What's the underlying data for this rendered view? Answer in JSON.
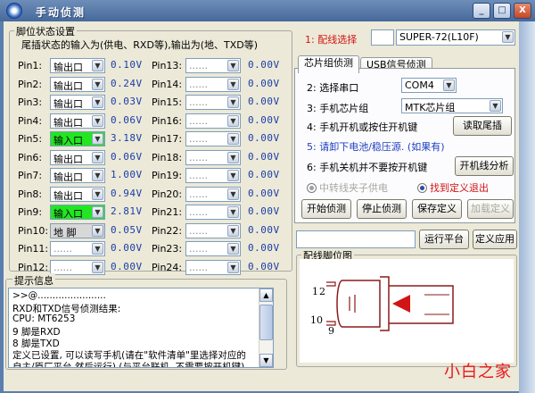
{
  "window": {
    "title": "手动侦测",
    "btn_min": "_",
    "btn_max": "□",
    "btn_close": "X"
  },
  "pin_group": {
    "title": "脚位状态设置",
    "desc": "尾插状态的输入为(供电、RXD等),输出为(地、TXD等)",
    "left_pins": [
      {
        "label": "Pin1:",
        "mode": "输出口",
        "value": "0.10V",
        "style": "normal"
      },
      {
        "label": "Pin2:",
        "mode": "输出口",
        "value": "0.24V",
        "style": "normal"
      },
      {
        "label": "Pin3:",
        "mode": "输出口",
        "value": "0.03V",
        "style": "normal"
      },
      {
        "label": "Pin4:",
        "mode": "输出口",
        "value": "0.06V",
        "style": "normal"
      },
      {
        "label": "Pin5:",
        "mode": "输入口",
        "value": "3.18V",
        "style": "green"
      },
      {
        "label": "Pin6:",
        "mode": "输出口",
        "value": "0.06V",
        "style": "normal"
      },
      {
        "label": "Pin7:",
        "mode": "输出口",
        "value": "1.00V",
        "style": "normal"
      },
      {
        "label": "Pin8:",
        "mode": "输出口",
        "value": "0.94V",
        "style": "normal"
      },
      {
        "label": "Pin9:",
        "mode": "输入口",
        "value": "2.81V",
        "style": "green"
      },
      {
        "label": "Pin10:",
        "mode": "地 脚",
        "value": "0.05V",
        "style": "gray"
      },
      {
        "label": "Pin11:",
        "mode": "......",
        "value": "0.00V",
        "style": "dotted"
      },
      {
        "label": "Pin12:",
        "mode": "......",
        "value": "0.00V",
        "style": "dotted"
      }
    ],
    "right_pins": [
      {
        "label": "Pin13:",
        "mode": "......",
        "value": "0.00V"
      },
      {
        "label": "Pin14:",
        "mode": "......",
        "value": "0.00V"
      },
      {
        "label": "Pin15:",
        "mode": "......",
        "value": "0.00V"
      },
      {
        "label": "Pin16:",
        "mode": "......",
        "value": "0.00V"
      },
      {
        "label": "Pin17:",
        "mode": "......",
        "value": "0.00V"
      },
      {
        "label": "Pin18:",
        "mode": "......",
        "value": "0.00V"
      },
      {
        "label": "Pin19:",
        "mode": "......",
        "value": "0.00V"
      },
      {
        "label": "Pin20:",
        "mode": "......",
        "value": "0.00V"
      },
      {
        "label": "Pin21:",
        "mode": "......",
        "value": "0.00V"
      },
      {
        "label": "Pin22:",
        "mode": "......",
        "value": "0.00V"
      },
      {
        "label": "Pin23:",
        "mode": "......",
        "value": "0.00V"
      },
      {
        "label": "Pin24:",
        "mode": "......",
        "value": "0.00V"
      }
    ]
  },
  "cable": {
    "label": "1: 配线选择",
    "value": "SUPER-72(L10F)"
  },
  "tabs": {
    "chip": "芯片组侦测",
    "usb": "USB信号侦测"
  },
  "chip_panel": {
    "step2": "2: 选择串口",
    "port": "COM4",
    "step3": "3: 手机芯片组",
    "chipset": "MTK芯片组",
    "step4": "4: 手机开机或按住开机键",
    "read_tail": "读取尾插",
    "step5": "5: 请卸下电池/稳压源. (如果有)",
    "step6": "6: 手机关机并不要按开机键",
    "boot_analysis": "开机线分析",
    "opt_clip": "中转线夹子供电",
    "opt_found": "找到定义退出",
    "start": "开始侦测",
    "stop": "停止侦测",
    "save": "保存定义",
    "restore": "加载定义"
  },
  "platform": {
    "run": "运行平台",
    "define": "定义应用"
  },
  "diagram": {
    "title": "配线脚位图",
    "pin1": "1",
    "pin2": "2",
    "pin9": "9",
    "pin10": "10"
  },
  "log": {
    "title": "提示信息",
    "lines": [
      ">>@.......................",
      "RXD和TXD信号侦测结果:",
      "CPU: MT6253",
      "9 脚是RXD",
      "8 脚是TXD",
      "定义已设置, 可以读写手机(请在\"软件清单\"里选择对应的",
      "自主/原厂平台,然后运行).(与平台联机, 不需要按开机键)"
    ]
  },
  "watermark": "小白之家"
}
